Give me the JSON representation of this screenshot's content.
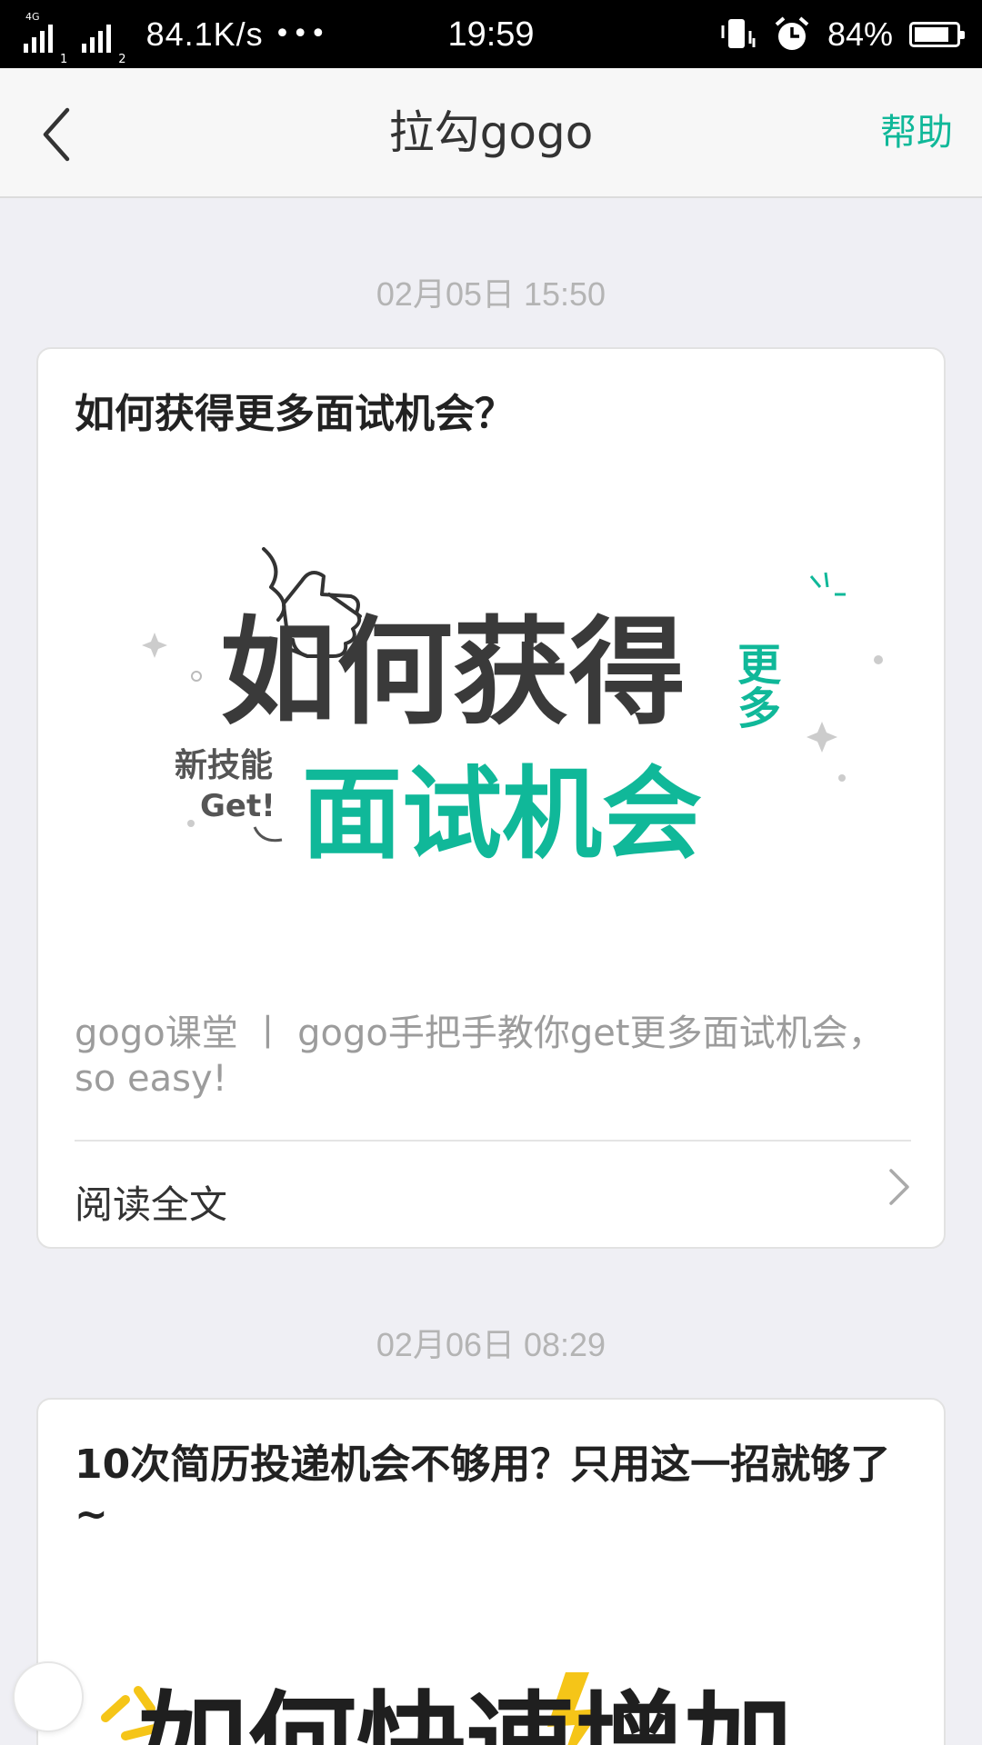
{
  "status_bar": {
    "network_type": "4G",
    "sim1": "1",
    "sim2": "2",
    "speed": "84.1K/s",
    "more": "•••",
    "time": "19:59",
    "battery": "84%",
    "battery_level": 0.84,
    "icons": [
      "signal-icon",
      "vibrate-icon",
      "alarm-icon",
      "battery-icon"
    ]
  },
  "nav": {
    "title": "拉勾gogo",
    "help": "帮助",
    "back_icon": "chevron-left-icon"
  },
  "messages": [
    {
      "timestamp": "02月05日 15:50",
      "title": "如何获得更多面试机会？",
      "image": {
        "line1": "如何获得",
        "line1_side": "更多",
        "line2": "面试机会",
        "badge_top": "新技能",
        "badge_bottom": "Get!"
      },
      "description": "gogo课堂 丨 gogo手把手教你get更多面试机会，so easy!",
      "read_more": "阅读全文"
    },
    {
      "timestamp": "02月06日 08:29",
      "title": "10次简历投递机会不够用？只用这一招就够了~",
      "image": {
        "text": "如何快速增加"
      }
    }
  ],
  "colors": {
    "accent": "#10b899",
    "background": "#efeff4",
    "title": "#222222",
    "muted": "#9c9c9c",
    "banner_dark": "#3a3a3a",
    "banner_yellow": "#f5c518"
  }
}
